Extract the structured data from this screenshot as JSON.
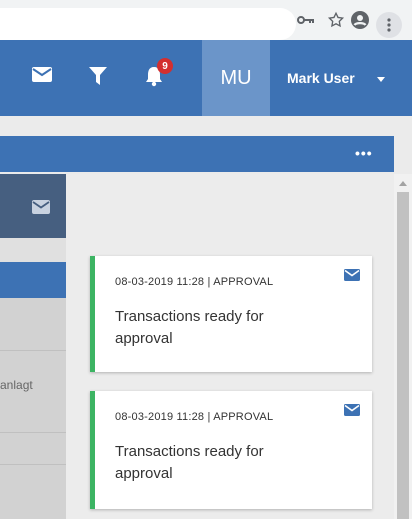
{
  "browser": {
    "icons": [
      "key-icon",
      "star-icon",
      "account-icon",
      "more-vert-icon"
    ]
  },
  "appbar": {
    "notification_count": "9",
    "avatar_initials": "MU",
    "user_name": "Mark User",
    "icons": [
      "mail-icon",
      "filter-icon",
      "bell-icon",
      "dropdown-caret-icon"
    ],
    "color": "#3d72b4"
  },
  "subbar": {
    "more_label": "•••"
  },
  "left_panel": {
    "truncated_text": "anlagt"
  },
  "notifications": [
    {
      "meta": "08-03-2019 11:28 | APPROVAL",
      "message": "Transactions ready for approval",
      "accent_color": "#3cb463"
    },
    {
      "meta": "08-03-2019 11:28 | APPROVAL",
      "message": "Transactions ready for approval",
      "accent_color": "#3cb463"
    }
  ]
}
